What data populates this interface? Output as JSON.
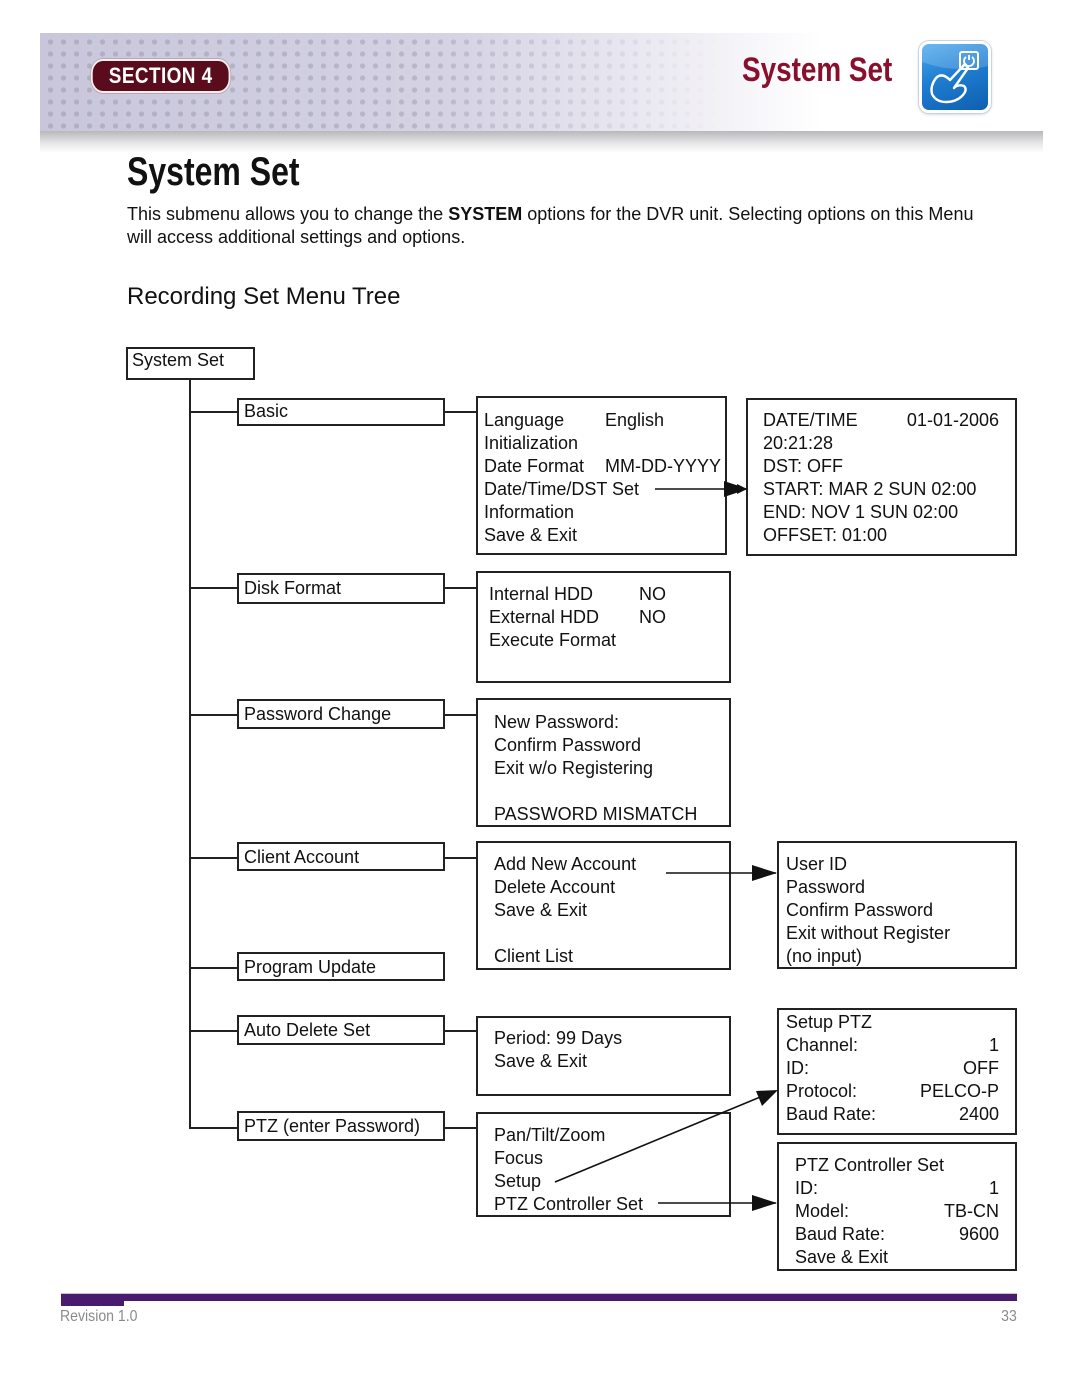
{
  "header": {
    "section_label": "SECTION 4",
    "banner_title": "System Set",
    "icon": "touch-hand-power-icon",
    "colors": {
      "section_pill": "#5a0c1c",
      "banner_title": "#8a0f2c",
      "icon_blue": "#1f7ed2",
      "footer_bar": "#4a1a6e"
    }
  },
  "page": {
    "title": "System Set",
    "intro_before": "This submenu allows you to change the ",
    "intro_bold": "SYSTEM",
    "intro_after": " options for the DVR unit. Selecting options on this Menu will access additional settings and options.",
    "subheading": "Recording Set Menu Tree"
  },
  "tree": {
    "root": "System Set",
    "branches": [
      {
        "label": "Basic"
      },
      {
        "label": "Disk Format"
      },
      {
        "label": "Password Change"
      },
      {
        "label": "Client Account"
      },
      {
        "label": "Program Update"
      },
      {
        "label": "Auto Delete Set"
      },
      {
        "label": "PTZ (enter Password)"
      }
    ],
    "basic_menu": [
      {
        "key": "Language",
        "value": "English"
      },
      {
        "key": "Initialization",
        "value": ""
      },
      {
        "key": "Date Format",
        "value": "MM-DD-YYYY"
      },
      {
        "key": "Date/Time/DST Set",
        "value": ""
      },
      {
        "key": "Information",
        "value": ""
      },
      {
        "key": "Save & Exit",
        "value": ""
      }
    ],
    "datetime_menu": [
      {
        "key": "DATE/TIME",
        "value": "01-01-2006"
      },
      {
        "key": "20:21:28",
        "value": ""
      },
      {
        "key": "DST: OFF",
        "value": ""
      },
      {
        "key": "START: MAR 2 SUN 02:00",
        "value": ""
      },
      {
        "key": "END: NOV 1 SUN 02:00",
        "value": ""
      },
      {
        "key": "OFFSET: 01:00",
        "value": ""
      }
    ],
    "disk_menu": [
      {
        "key": "Internal HDD",
        "value": "NO"
      },
      {
        "key": "External HDD",
        "value": "NO"
      },
      {
        "key": "Execute Format",
        "value": ""
      }
    ],
    "password_menu": [
      "New Password:",
      "Confirm Password",
      "Exit w/o Registering",
      "",
      "PASSWORD MISMATCH"
    ],
    "client_menu": [
      "Add New Account",
      "Delete Account",
      "Save & Exit",
      "",
      "Client List"
    ],
    "new_account_menu": [
      "User ID",
      "Password",
      "Confirm Password",
      "Exit without Register",
      "(no input)"
    ],
    "auto_delete_menu": [
      "Period: 99 Days",
      "Save & Exit"
    ],
    "ptz_menu": [
      "Pan/Tilt/Zoom",
      "Focus",
      "Setup",
      "PTZ Controller Set"
    ],
    "setup_ptz_menu": {
      "title": "Setup PTZ",
      "rows": [
        {
          "key": "Channel:",
          "value": "1"
        },
        {
          "key": "ID:",
          "value": "OFF"
        },
        {
          "key": "Protocol:",
          "value": "PELCO-P"
        },
        {
          "key": "Baud Rate:",
          "value": "2400"
        }
      ]
    },
    "ptz_controller_menu": {
      "title": "PTZ Controller Set",
      "rows": [
        {
          "key": "ID:",
          "value": "1"
        },
        {
          "key": "Model:",
          "value": "TB-CN"
        },
        {
          "key": "Baud Rate:",
          "value": "9600"
        },
        {
          "key": "Save & Exit",
          "value": ""
        }
      ]
    }
  },
  "footer": {
    "revision": "Revision 1.0",
    "page_number": "33"
  }
}
